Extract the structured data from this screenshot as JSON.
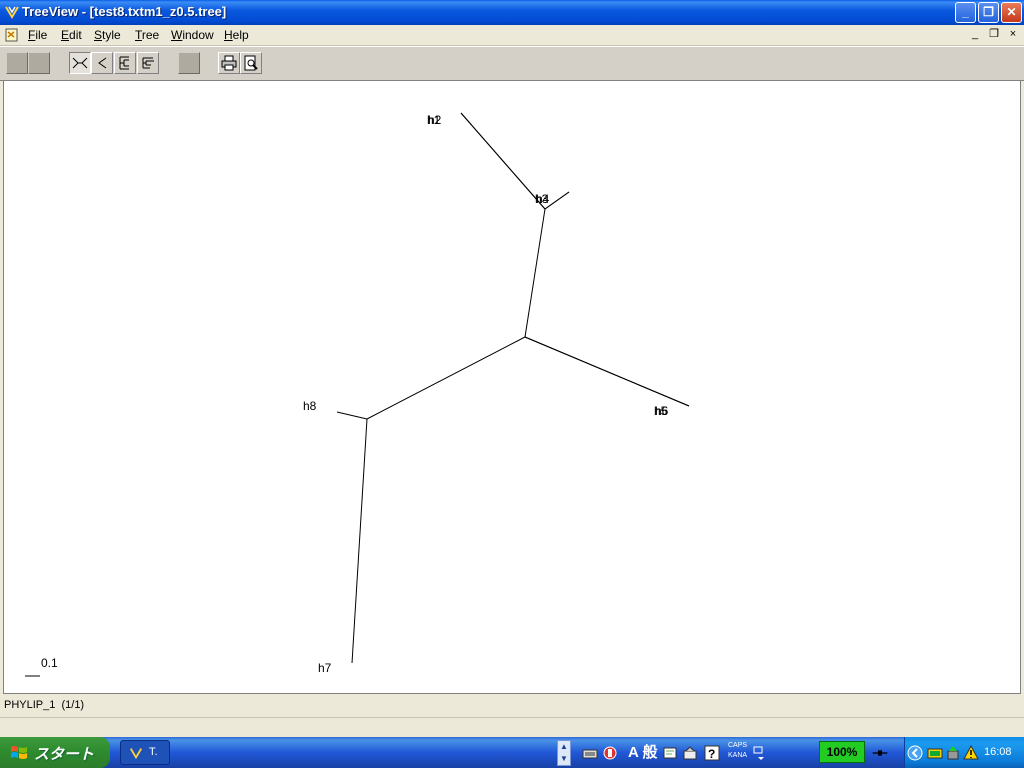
{
  "window": {
    "title": "TreeView - [test8.txtm1_z0.5.tree]",
    "buttons": {
      "minimize": "_",
      "maximize": "❐",
      "close": "✕"
    }
  },
  "menu": {
    "items": [
      {
        "key": "F",
        "rest": "ile"
      },
      {
        "key": "E",
        "rest": "dit"
      },
      {
        "key": "S",
        "rest": "tyle"
      },
      {
        "key": "T",
        "rest": "ree"
      },
      {
        "key": "W",
        "rest": "indow"
      },
      {
        "key": "H",
        "rest": "elp"
      }
    ],
    "mdi": {
      "minimize": "_",
      "restore": "❐",
      "close": "×"
    }
  },
  "toolbar": {
    "buttons": [
      "blank-1",
      "blank-2",
      "unrooted-tree",
      "slanted-cladogram",
      "rectangular-cladogram",
      "phylogram",
      "blank-3",
      "print",
      "print-preview"
    ]
  },
  "tree": {
    "leaves": [
      {
        "label": "h1"
      },
      {
        "label": "h2"
      },
      {
        "label": "h3"
      },
      {
        "label": "h4"
      },
      {
        "label": "h5"
      },
      {
        "label": "h6"
      },
      {
        "label": "h7"
      },
      {
        "label": "h8"
      }
    ],
    "scale_label": "0.1"
  },
  "status": {
    "text": "PHYLIP_1  (1/1)"
  },
  "taskbar": {
    "start_label": "スタート",
    "task_label": "T.",
    "ime_mode": "A 般",
    "caps": "CAPS",
    "kana": "KANA",
    "battery": "100%",
    "clock": "16:08"
  },
  "colors": {
    "titlebar": "#0b5ae0",
    "taskbar": "#2157d7",
    "start": "#2e8a2e",
    "battery": "#22cc22",
    "canvas": "#ffffff"
  }
}
